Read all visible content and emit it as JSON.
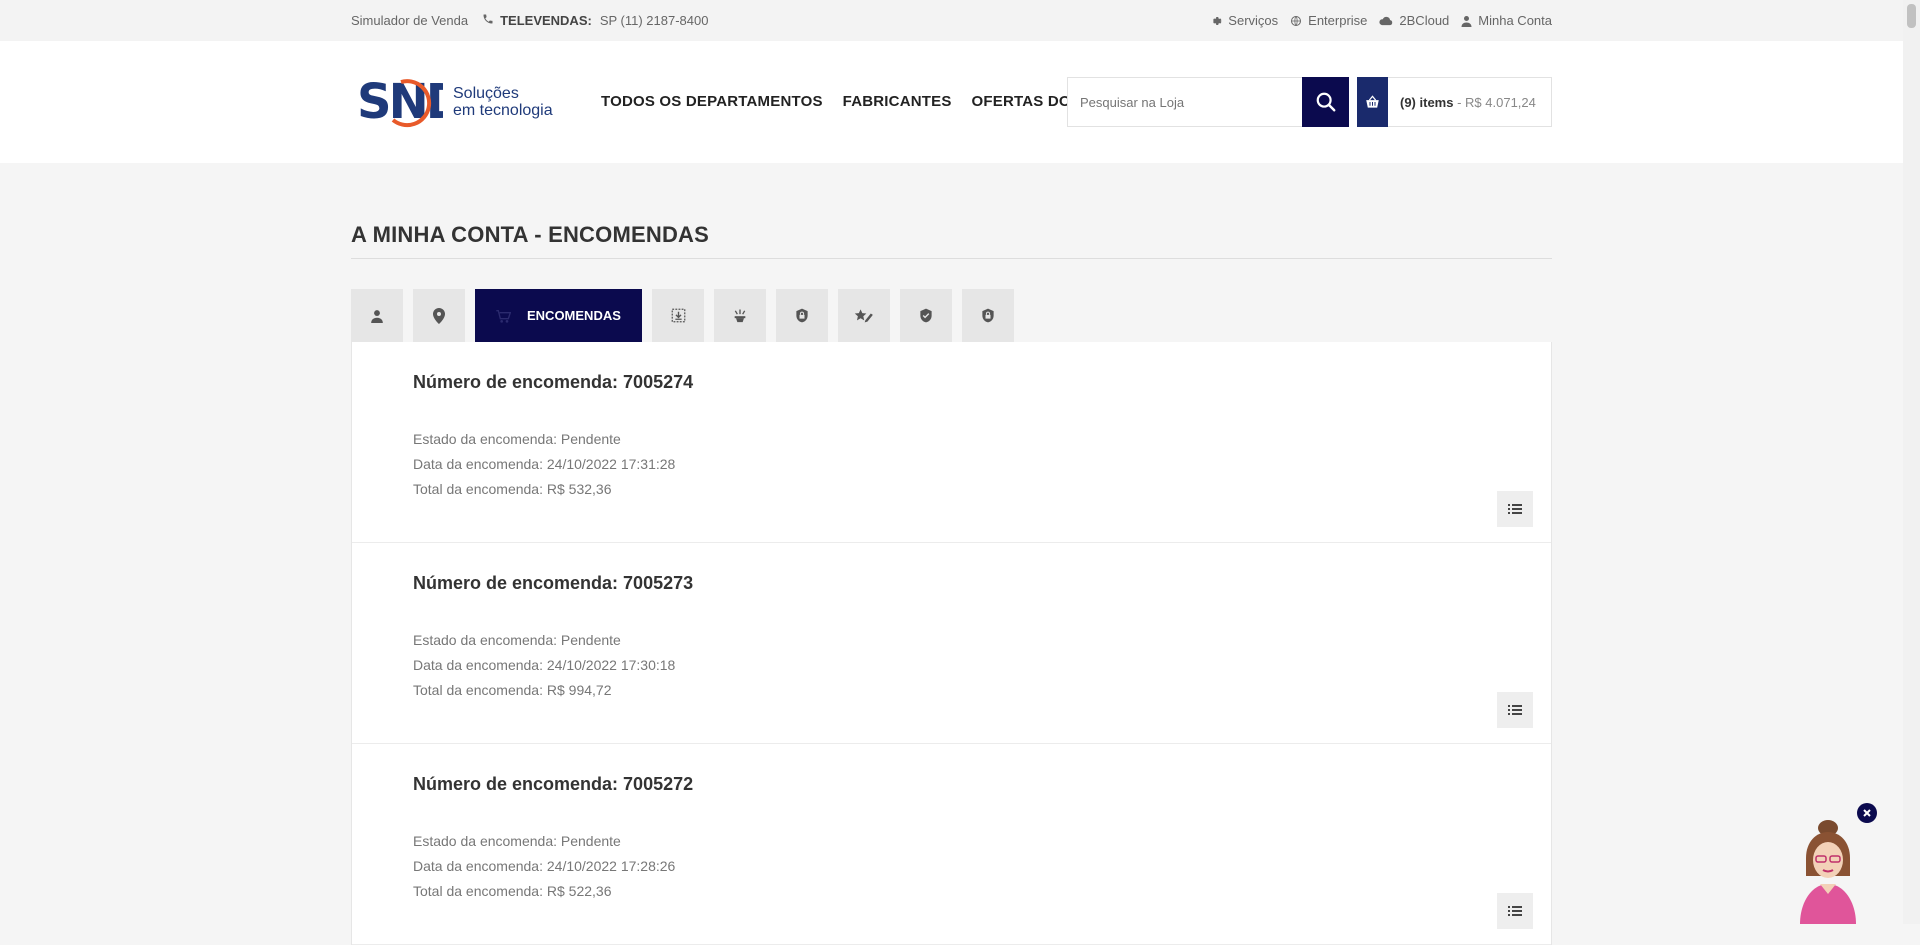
{
  "topbar": {
    "simulator": "Simulador de Venda",
    "tel_label": "TELEVENDAS:",
    "tel_value": "SP (11)  2187-8400",
    "links": [
      "Serviços",
      "Enterprise",
      "2BCloud",
      "Minha Conta"
    ]
  },
  "header": {
    "logo_text": "SND",
    "logo_tagline_1": "Soluções",
    "logo_tagline_2": "em tecnologia",
    "nav": [
      "TODOS OS DEPARTAMENTOS",
      "FABRICANTES",
      "OFERTAS DO DIA"
    ],
    "search_placeholder": "Pesquisar na Loja",
    "cart_count": "(9) items",
    "cart_total": "- R$ 4.071,24"
  },
  "page": {
    "title": "A MINHA CONTA - ENCOMENDAS"
  },
  "tabs": {
    "active_label": "ENCOMENDAS",
    "icons": [
      "user-icon",
      "location-icon",
      "orders-icon",
      "download-icon",
      "spotlight-icon",
      "lock-badge-icon",
      "star-pencil-icon",
      "shield-icon",
      "lock-badge-icon"
    ]
  },
  "orders": [
    {
      "number_label": "Número de encomenda: 7005274",
      "status": "Estado da encomenda: Pendente",
      "date": "Data da encomenda: 24/10/2022 17:31:28",
      "total": "Total da encomenda: R$ 532,36"
    },
    {
      "number_label": "Número de encomenda: 7005273",
      "status": "Estado da encomenda: Pendente",
      "date": "Data da encomenda: 24/10/2022 17:30:18",
      "total": "Total da encomenda: R$ 994,72"
    },
    {
      "number_label": "Número de encomenda: 7005272",
      "status": "Estado da encomenda: Pendente",
      "date": "Data da encomenda: 24/10/2022 17:28:26",
      "total": "Total da encomenda: R$ 522,36"
    }
  ],
  "colors": {
    "brand_navy": "#0b0a4e",
    "logo_blue": "#1f3a7a",
    "logo_orange": "#e85a2a"
  }
}
